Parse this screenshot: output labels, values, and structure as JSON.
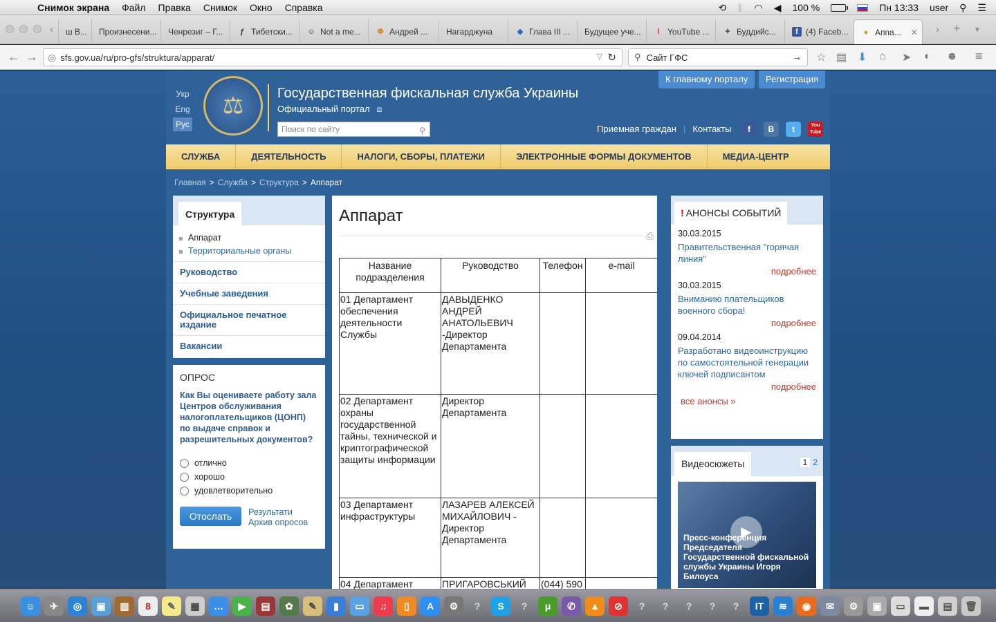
{
  "menubar": {
    "app": "Снимок экрана",
    "items": [
      "Файл",
      "Правка",
      "Снимок",
      "Окно",
      "Справка"
    ],
    "battery": "100 %",
    "clock": "Пн 13:33",
    "user": "user"
  },
  "tabs": [
    {
      "label": "ш В..."
    },
    {
      "label": "Произнесени..."
    },
    {
      "label": "Ченрезиг – Г..."
    },
    {
      "label": "Тибетски..."
    },
    {
      "label": "Not a me..."
    },
    {
      "label": "Андрей ..."
    },
    {
      "label": "Нагарджуна"
    },
    {
      "label": "Глава III ..."
    },
    {
      "label": "Будущее уче..."
    },
    {
      "label": "YouTube ..."
    },
    {
      "label": "Буддийс..."
    },
    {
      "label": "(4) Faceb..."
    },
    {
      "label": "Аппа..."
    }
  ],
  "toolbar": {
    "url": "sfs.gov.ua/ru/pro-gfs/struktura/apparat/",
    "search": "Сайт ГФС"
  },
  "site": {
    "languages": [
      "Укр",
      "Eng",
      "Рус"
    ],
    "title": "Государственная фискальная служба Украины",
    "portal": "Официальный портал",
    "search_placeholder": "Поиск по сайту",
    "top_buttons": [
      "К главному порталу",
      "Регистрация"
    ],
    "top_links": [
      "Приемная граждан",
      "Контакты"
    ],
    "social": [
      "f",
      "В",
      "t",
      "You Tube"
    ]
  },
  "nav": [
    "СЛУЖБА",
    "ДЕЯТЕЛЬНОСТЬ",
    "НАЛОГИ, СБОРЫ, ПЛАТЕЖИ",
    "ЭЛЕКТРОННЫЕ ФОРМЫ ДОКУМЕНТОВ",
    "МЕДИА-ЦЕНТР"
  ],
  "breadcrumb": {
    "items": [
      "Главная",
      "Служба",
      "Структура"
    ],
    "current": "Аппарат"
  },
  "left": {
    "heading": "Структура",
    "sub": [
      "Аппарат",
      "Территориальные органы"
    ],
    "links": [
      "Руководство",
      "Учебные заведения",
      "Официальное печатное издание",
      "Вакансии"
    ]
  },
  "poll": {
    "heading": "ОПРОС",
    "question": "Как Вы оцениваете работу зала Центров обслуживания налогоплательщиков (ЦОНП) по выдаче справок и разрешительных документов?",
    "options": [
      "отлично",
      "хорошо",
      "удовлетворительно"
    ],
    "submit": "Отослать",
    "results": "Результати",
    "archive": "Архив опросов"
  },
  "content": {
    "title": "Аппарат",
    "columns": [
      "Название подразделения",
      "Руководство",
      "Телефон",
      "e-mail"
    ],
    "rows": [
      [
        "01 Департамент обеспечения деятельности Службы",
        "ДАВЫДЕНКО АНДРЕЙ АНАТОЛЬЕВИЧ -Директор Департамента",
        "",
        ""
      ],
      [
        "02 Департамент охраны государственной тайны, технической и криптографической защиты информации",
        "Директор Департамента",
        "",
        ""
      ],
      [
        "03 Департамент инфраструктуры",
        "ЛАЗАРЕВ АЛЕКСЕЙ МИХАЙЛОВИЧ - Директор Департамента",
        "",
        ""
      ],
      [
        "04 Департамент",
        "ПРИГАРОВСЬКИЙ",
        "(044) 590",
        ""
      ]
    ]
  },
  "announcements": {
    "heading": "АНОНСЫ СОБЫТИЙ",
    "items": [
      {
        "date": "30.03.2015",
        "title": "Правительственная \"горячая линия\"",
        "more": "подробнее"
      },
      {
        "date": "30.03.2015",
        "title": "Вниманию плательщиков военного сбора!",
        "more": "подробнее"
      },
      {
        "date": "09.04.2014",
        "title": "Разработано видеоинструкцию по самостоятельной генерации ключей подписантом",
        "more": "подробнее"
      }
    ],
    "all": "все анонсы »"
  },
  "video": {
    "heading": "Видеосюжеты",
    "pages": [
      "1",
      "2"
    ],
    "caption": "Пресс-конференция Председателя Государственной фискальной службы Украины Игоря Билоуса"
  }
}
